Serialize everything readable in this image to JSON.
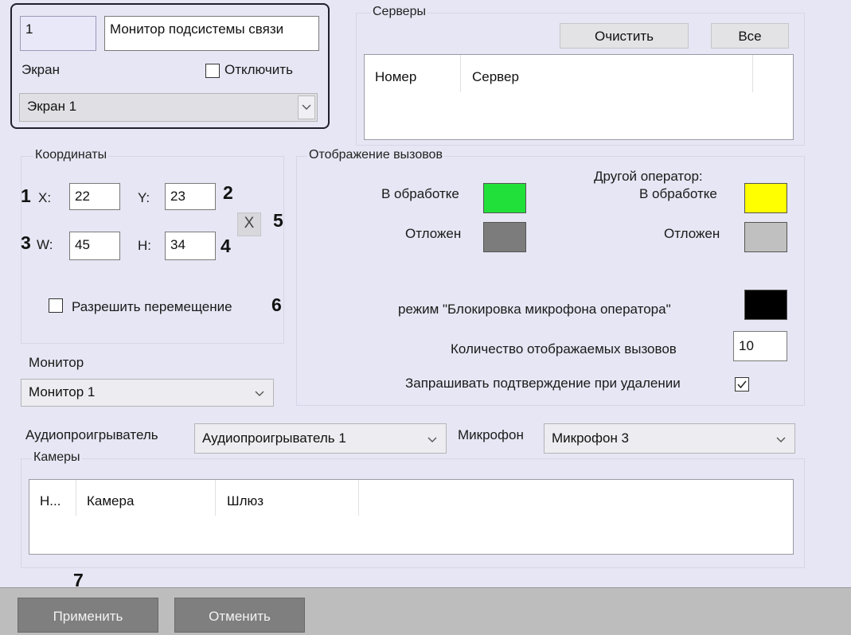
{
  "object": {
    "id": "1",
    "name": "Монитор подсистемы связи",
    "screen_label": "Экран",
    "disable_label": "Отключить",
    "disable_checked": false,
    "screen_value": "Экран 1"
  },
  "servers": {
    "legend": "Серверы",
    "clear_button": "Очистить",
    "all_button": "Все",
    "columns": [
      "Номер",
      "Сервер"
    ]
  },
  "coordinates": {
    "legend": "Координаты",
    "x_label": "X:",
    "x_value": "22",
    "y_label": "Y:",
    "y_value": "23",
    "w_label": "W:",
    "w_value": "45",
    "h_label": "H:",
    "h_value": "34",
    "reset_button": "X",
    "allow_move_label": "Разрешить перемещение",
    "allow_move_checked": false
  },
  "calls": {
    "legend": "Отображение вызовов",
    "processing_label": "В обработке",
    "postponed_label": "Отложен",
    "other_operator_label": "Другой оператор:",
    "other_processing_label": "В обработке",
    "other_postponed_label": "Отложен",
    "mic_block_label": "режим \"Блокировка микрофона оператора\"",
    "count_label": "Количество отображаемых вызовов",
    "count_value": "10",
    "confirm_delete_label": "Запрашивать подтверждение при удалении",
    "confirm_delete_checked": true,
    "colors": {
      "processing": "#22e03a",
      "postponed": "#7c7c7c",
      "other_processing": "#ffff00",
      "other_postponed": "#c0c0c0",
      "mic_block": "#000000"
    }
  },
  "monitor": {
    "label": "Монитор",
    "value": "Монитор 1"
  },
  "audio": {
    "player_label": "Аудиопроигрыватель",
    "player_value": "Аудиопроигрыватель 1",
    "mic_label": "Микрофон",
    "mic_value": "Микрофон 3"
  },
  "cameras": {
    "legend": "Камеры",
    "columns": [
      "Н...",
      "Камера",
      "Шлюз"
    ]
  },
  "footer": {
    "apply": "Применить",
    "cancel": "Отменить"
  },
  "markers": [
    "1",
    "2",
    "3",
    "4",
    "5",
    "6",
    "7"
  ]
}
